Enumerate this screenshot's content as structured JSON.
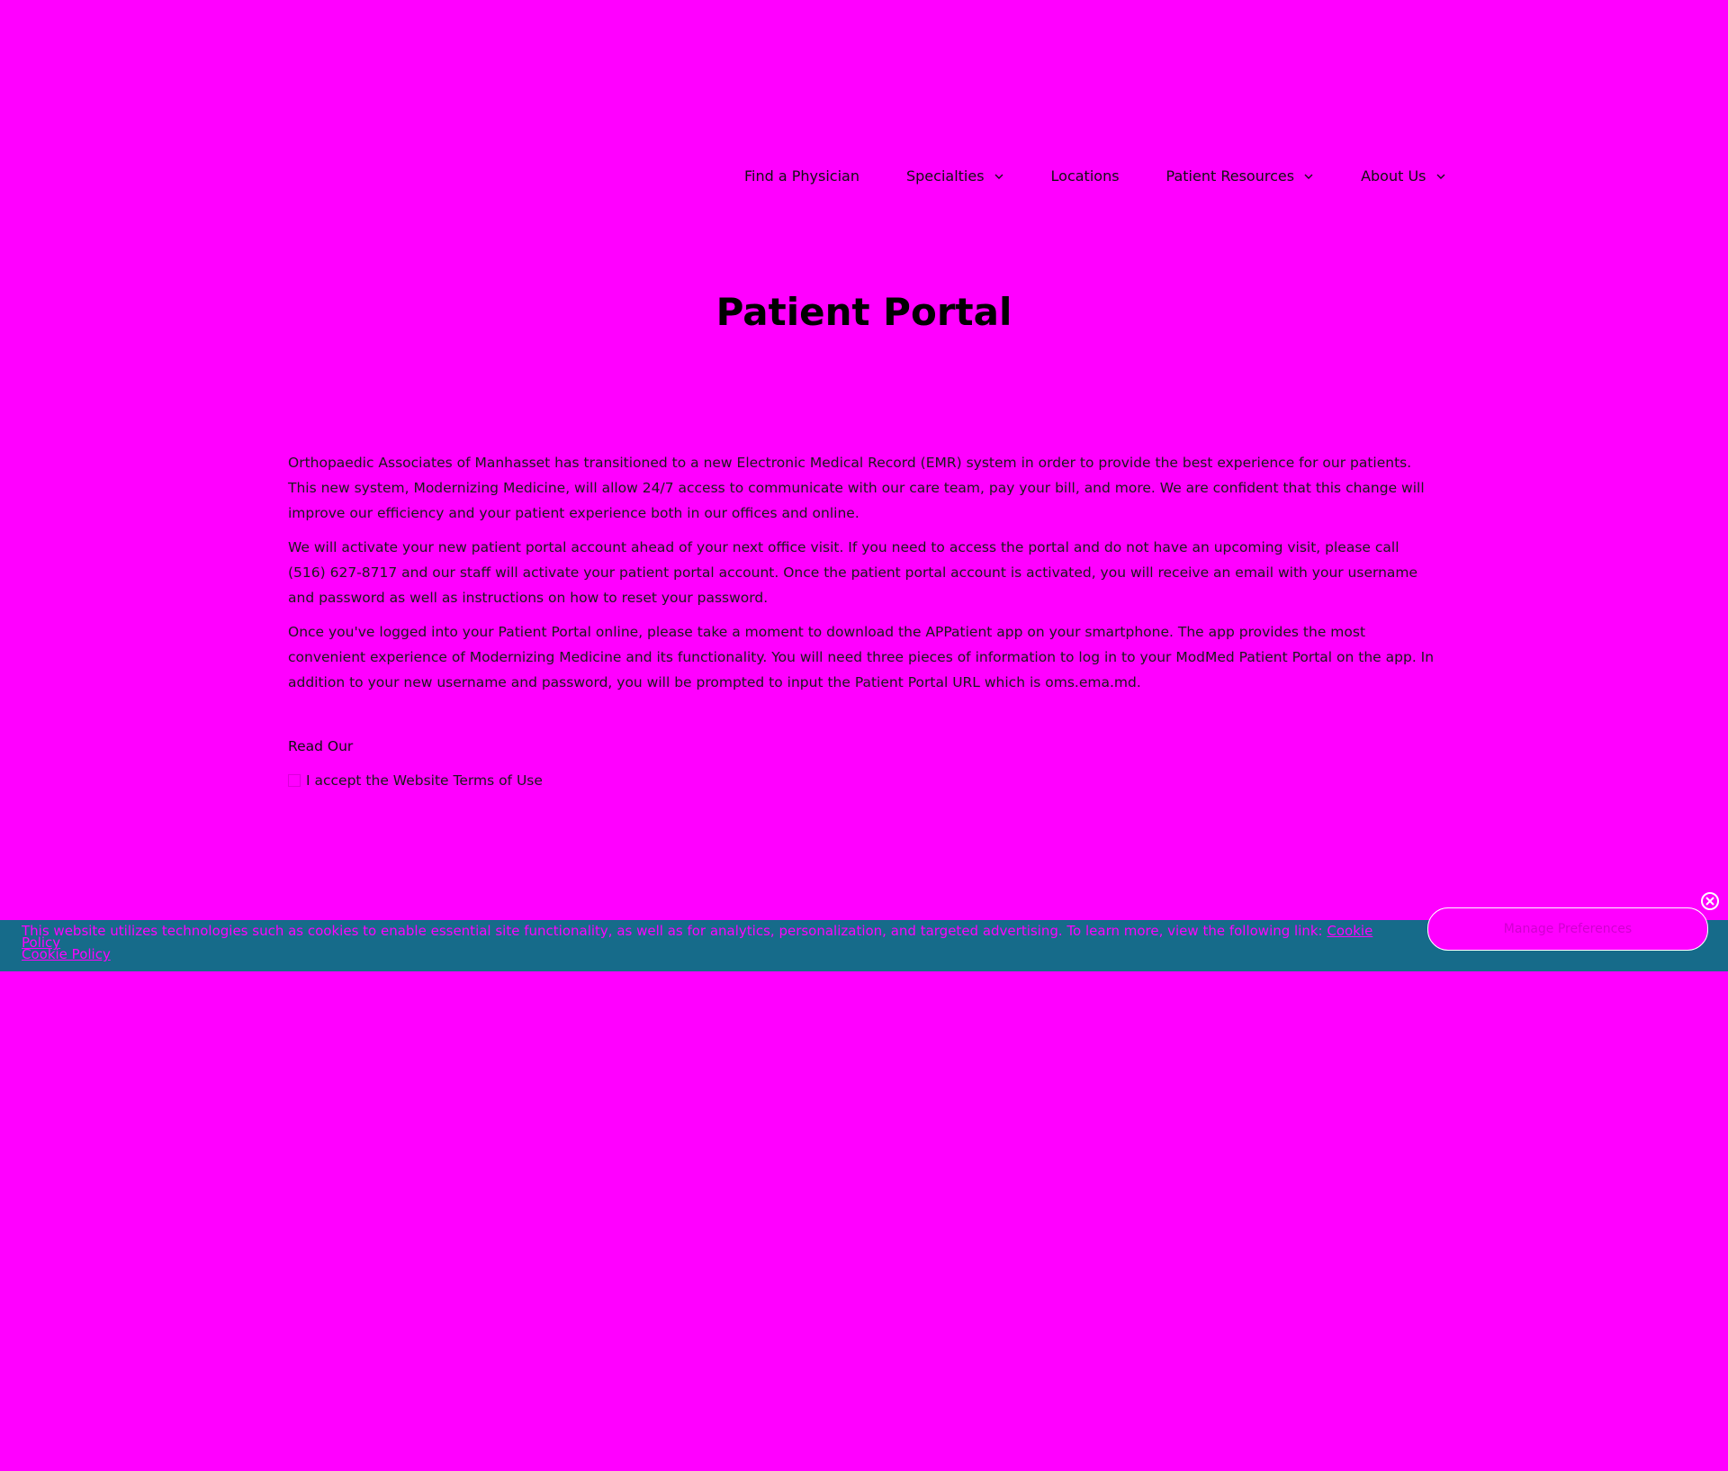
{
  "nav": {
    "items": [
      {
        "label": "Find a Physician",
        "has_dropdown": false
      },
      {
        "label": "Specialties",
        "has_dropdown": true
      },
      {
        "label": "Locations",
        "has_dropdown": false
      },
      {
        "label": "Patient Resources",
        "has_dropdown": true
      },
      {
        "label": "About Us",
        "has_dropdown": true
      }
    ]
  },
  "page": {
    "title": "Patient Portal",
    "paragraphs": [
      "Orthopaedic Associates of Manhasset has transitioned to a new Electronic Medical Record (EMR) system in order to provide the best experience for our patients. This new system, Modernizing Medicine, will allow 24/7 access to communicate with our care team, pay your bill, and more. We are confident that this change will improve our efficiency and your patient experience both in our offices and online.",
      "We will activate your new patient portal account ahead of your next office visit. If you need to access the portal and do not have an upcoming visit, please call (516) 627-8717 and our staff will activate your patient portal account. Once the patient portal account is activated, you will receive an email with your username and password as well as instructions on how to reset your password.",
      "Once you've logged into your Patient Portal online, please take a moment to download the APPatient app on your smartphone. The app provides the most convenient experience of Modernizing Medicine and its functionality. You will need three pieces of information to log in to your ModMed Patient Portal on the app. In addition to your new username and password, you will be prompted to input the Patient Portal URL which is oms.ema.md."
    ],
    "read_our": "Read Our",
    "accept_label": "I accept the Website Terms of Use"
  },
  "cookie": {
    "text": "This website utilizes technologies such as cookies to enable essential site functionality, as well as for analytics, personalization, and targeted advertising. To learn more, view the following link:",
    "link1": "Cookie Policy",
    "link2": "Cookie Policy",
    "manage_label": "Manage Preferences",
    "bar_color": "#166b8a"
  },
  "colors": {
    "background": "#ff00ff",
    "text": "#000000"
  },
  "icons": {
    "dropdown": "chevron-down-icon",
    "close": "close-icon"
  }
}
